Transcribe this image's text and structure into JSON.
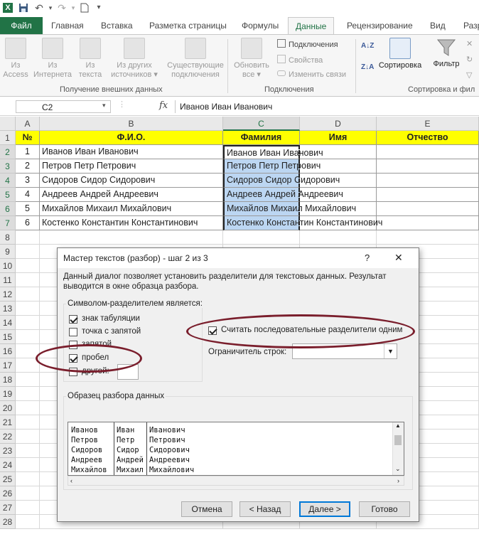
{
  "window": {
    "qat_icons": [
      "excel-icon",
      "save-icon",
      "undo-icon",
      "redo-icon",
      "new-icon",
      "customize-icon"
    ]
  },
  "ribbon": {
    "tabs": [
      {
        "label": "Файл",
        "id": "file"
      },
      {
        "label": "Главная",
        "id": "home"
      },
      {
        "label": "Вставка",
        "id": "insert"
      },
      {
        "label": "Разметка страницы",
        "id": "layout"
      },
      {
        "label": "Формулы",
        "id": "formulas"
      },
      {
        "label": "Данные",
        "id": "data",
        "active": true
      },
      {
        "label": "Рецензирование",
        "id": "review"
      },
      {
        "label": "Вид",
        "id": "view"
      },
      {
        "label": "Разр",
        "id": "dev"
      }
    ],
    "groups": {
      "external": {
        "label": "Получение внешних данных",
        "buttons": [
          {
            "l1": "Из",
            "l2": "Access"
          },
          {
            "l1": "Из",
            "l2": "Интернета"
          },
          {
            "l1": "Из",
            "l2": "текста"
          },
          {
            "l1": "Из других",
            "l2": "источников ▾"
          },
          {
            "l1": "Существующие",
            "l2": "подключения"
          }
        ]
      },
      "connections": {
        "label": "Подключения",
        "refresh_l1": "Обновить",
        "refresh_l2": "все ▾",
        "items": [
          "Подключения",
          "Свойства",
          "Изменить связи"
        ]
      },
      "sort": {
        "label": "Сортировка и фил",
        "sort_label": "Сортировка",
        "filter_label": "Фильтр"
      }
    }
  },
  "formula_bar": {
    "name_box": "C2",
    "fx": "fx",
    "content": "Иванов Иван Иванович"
  },
  "sheet": {
    "columns": [
      "A",
      "B",
      "C",
      "D",
      "E"
    ],
    "selected_column": "C",
    "rows": [
      "1",
      "2",
      "3",
      "4",
      "5",
      "6",
      "7",
      "8",
      "9",
      "10",
      "11",
      "12",
      "13",
      "14",
      "15",
      "16",
      "17",
      "18",
      "19",
      "20",
      "21",
      "22",
      "23",
      "24",
      "25",
      "26",
      "27",
      "28"
    ],
    "header_row": [
      "№",
      "Ф.И.О.",
      "Фамилия",
      "Имя",
      "Отчество"
    ],
    "data": [
      {
        "n": "1",
        "fio": "Иванов Иван Иванович",
        "c": "Иванов Иван Иванович"
      },
      {
        "n": "2",
        "fio": "Петров Петр Петрович",
        "c": "Петров Петр Петрович"
      },
      {
        "n": "3",
        "fio": "Сидоров Сидор Сидорович",
        "c": "Сидоров Сидор Сидорович"
      },
      {
        "n": "4",
        "fio": "Андреев Андрей Андреевич",
        "c": "Андреев Андрей Андреевич"
      },
      {
        "n": "5",
        "fio": "Михайлов Михаил Михайлович",
        "c": "Михайлов Михаил Михайлович"
      },
      {
        "n": "6",
        "fio": "Костенко Константин Константинович",
        "c": "Костенко Константин Константинович"
      }
    ]
  },
  "dialog": {
    "title": "Мастер текстов (разбор) - шаг 2 из 3",
    "help": "?",
    "close": "✕",
    "description_1": "Данный диалог позволяет установить разделители для текстовых данных. Результат",
    "description_2": "выводится в окне образца разбора.",
    "delim_group_label": "Символом-разделителем является:",
    "delims": [
      {
        "label": "знак табуляции",
        "checked": true
      },
      {
        "label": "точка с запятой",
        "checked": false
      },
      {
        "label": "запятой",
        "checked": false
      },
      {
        "label": "пробел",
        "checked": true
      },
      {
        "label": "другой:",
        "checked": false
      }
    ],
    "consecutive_label": "Считать последовательные разделители одним",
    "consecutive_checked": true,
    "qualifier_label": "Ограничитель строк:",
    "qualifier_value": "",
    "preview_label": "Образец разбора данных",
    "preview_cols": [
      [
        "Иванов",
        "Петров",
        "Сидоров",
        "Андреев",
        "Михайлов"
      ],
      [
        "Иван",
        "Петр",
        "Сидор",
        "Андрей",
        "Михаил"
      ],
      [
        "Иванович",
        "Петрович",
        "Сидорович",
        "Андреевич",
        "Михайлович"
      ]
    ],
    "buttons": {
      "cancel": "Отмена",
      "back": "< Назад",
      "next": "Далее >",
      "finish": "Готово"
    }
  },
  "annotation_color": "#7a1e2c"
}
